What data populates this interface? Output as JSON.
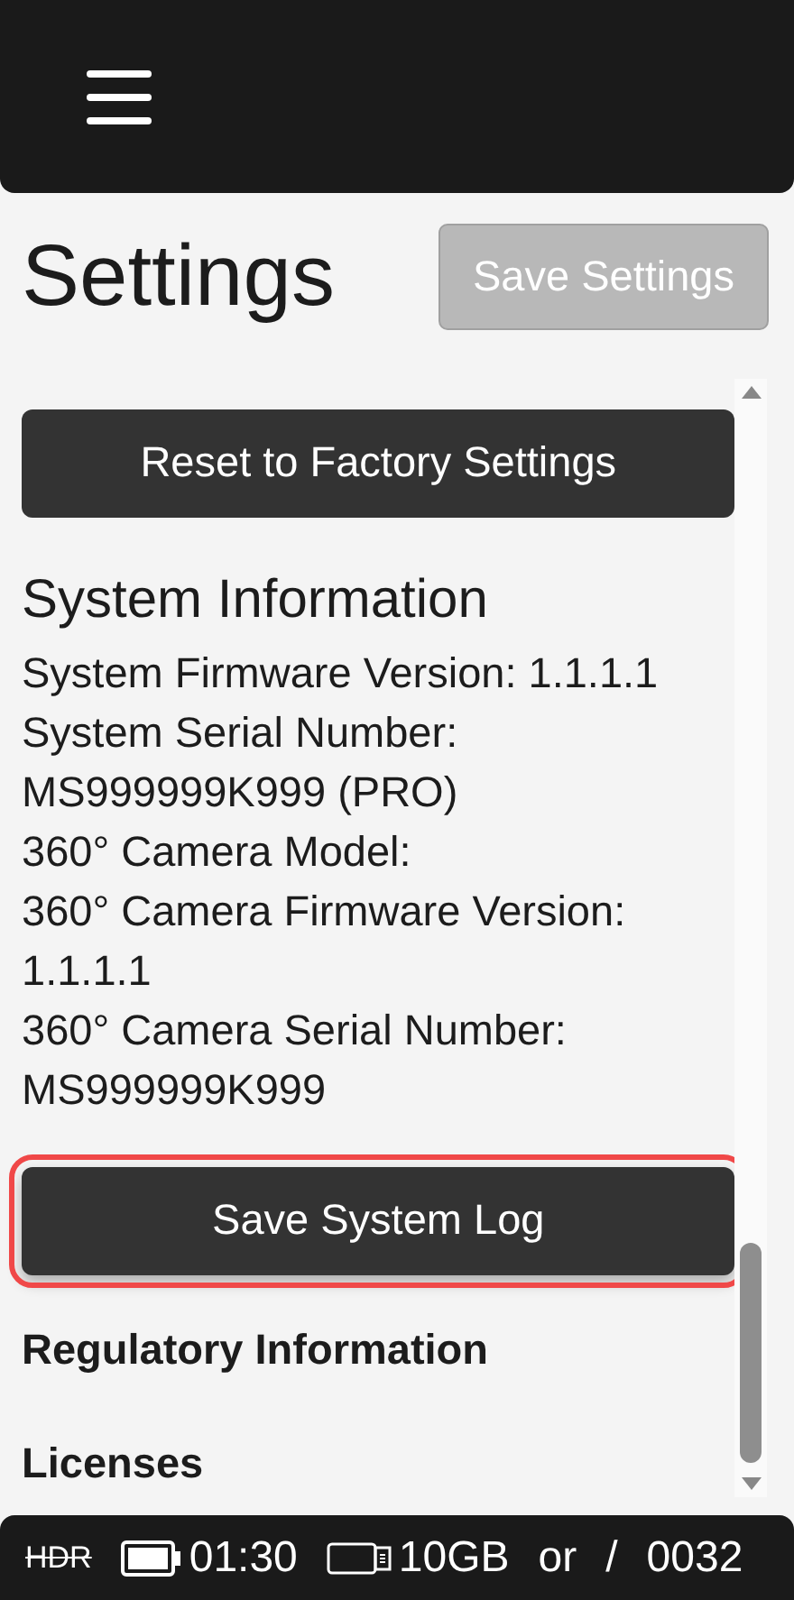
{
  "header": {
    "menu_icon": true
  },
  "title": "Settings",
  "save_button": {
    "label": "Save Settings",
    "disabled": true
  },
  "reset_button": {
    "label": "Reset to Factory Settings"
  },
  "system_information": {
    "heading": "System Information",
    "lines": [
      "System Firmware Version: 1.1.1.1",
      "System Serial Number: MS999999K999 (PRO)",
      "360° Camera Model:",
      "360° Camera Firmware Version: 1.1.1.1",
      "360° Camera Serial Number: MS999999K999"
    ]
  },
  "log_button": {
    "label": "Save System Log",
    "highlighted": true
  },
  "sections": [
    "Regulatory Information",
    "Licenses"
  ],
  "status_bar": {
    "hdr": {
      "label": "HDR",
      "disabled": true
    },
    "battery_time": "01:30",
    "storage": "10GB",
    "mode": "or",
    "separator": "/",
    "count": "0032"
  }
}
